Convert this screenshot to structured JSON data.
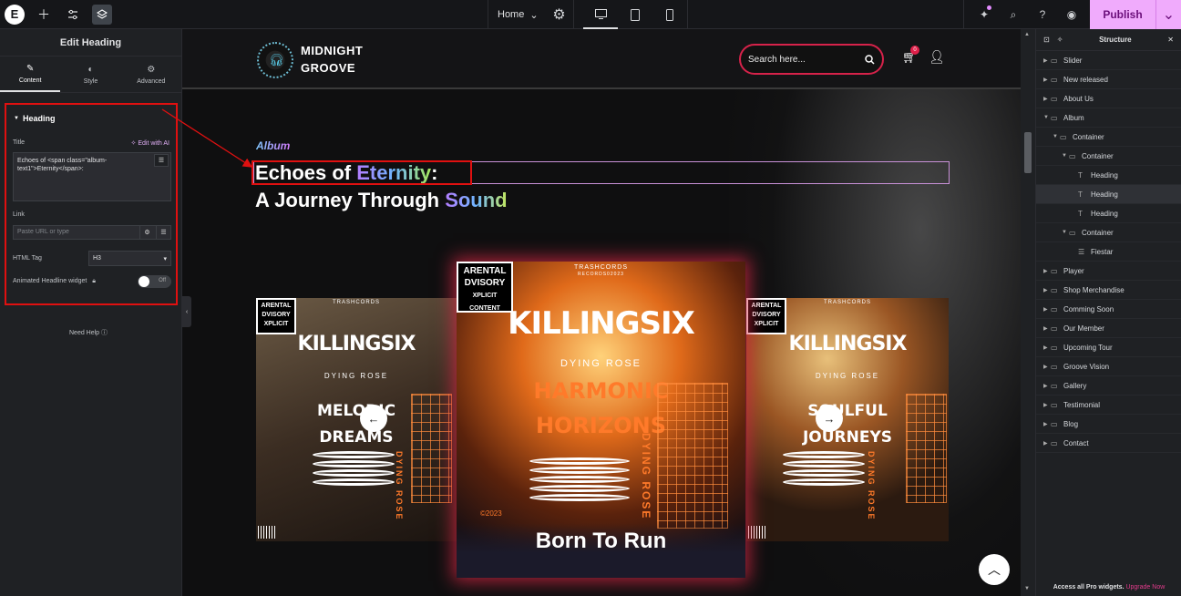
{
  "topbar": {
    "logo_letter": "E",
    "page_name": "Home",
    "publish_label": "Publish"
  },
  "left_panel": {
    "title": "Edit Heading",
    "tabs": [
      {
        "label": "Content"
      },
      {
        "label": "Style"
      },
      {
        "label": "Advanced"
      }
    ],
    "section_title": "Heading",
    "title_label": "Title",
    "edit_ai_label": "Edit with AI",
    "title_value": "Echoes of  <span class=\"album-text1\">Eternity</span>:",
    "link_label": "Link",
    "link_placeholder": "Paste URL or type",
    "html_tag_label": "HTML Tag",
    "html_tag_value": "H3",
    "animated_label": "Animated Headline widget",
    "toggle_off": "Off",
    "need_help": "Need Help"
  },
  "site": {
    "brand_line1": "MIDNIGHT",
    "brand_line2": "GROOVE",
    "search_placeholder": "Search here...",
    "cart_count": "0",
    "album_tag": "Album",
    "heading_line1_a": "Echoes of ",
    "heading_line1_b": "Eternity",
    "heading_line1_c": ":",
    "heading_line2_a": "A Journey Through ",
    "heading_line2_b": "Sound",
    "cards": {
      "label_small": "TRASHCORDS",
      "label_code": "RECORDS02023",
      "advisory": "ARENTAL\nDVISORY\nXPLICIT CONTENT",
      "band": "KILLINGSIX",
      "sub": "DYING ROSE",
      "left_title_1": "MELODIC",
      "left_title_2": "DREAMS",
      "center_title_1": "HARMONIC",
      "center_title_2": "HORIZONS",
      "right_title_1": "SOULFUL",
      "right_title_2": "JOURNEYS",
      "vertical": "DYING ROSE",
      "year": "©2023",
      "born": "Born To Run"
    }
  },
  "structure": {
    "title": "Structure",
    "items": [
      {
        "label": "Slider",
        "depth": 0,
        "caret": "▶",
        "icon": "▭"
      },
      {
        "label": "New released",
        "depth": 0,
        "caret": "▶",
        "icon": "▭"
      },
      {
        "label": "About Us",
        "depth": 0,
        "caret": "▶",
        "icon": "▭"
      },
      {
        "label": "Album",
        "depth": 0,
        "caret": "▼",
        "icon": "▭"
      },
      {
        "label": "Container",
        "depth": 1,
        "caret": "▼",
        "icon": "▭"
      },
      {
        "label": "Container",
        "depth": 2,
        "caret": "▼",
        "icon": "▭"
      },
      {
        "label": "Heading",
        "depth": 3,
        "caret": "",
        "icon": "T"
      },
      {
        "label": "Heading",
        "depth": 3,
        "caret": "",
        "icon": "T",
        "selected": true
      },
      {
        "label": "Heading",
        "depth": 3,
        "caret": "",
        "icon": "T"
      },
      {
        "label": "Container",
        "depth": 2,
        "caret": "▼",
        "icon": "▭"
      },
      {
        "label": "Fiestar",
        "depth": 3,
        "caret": "",
        "icon": "☰"
      },
      {
        "label": "Player",
        "depth": 0,
        "caret": "▶",
        "icon": "▭"
      },
      {
        "label": "Shop Merchandise",
        "depth": 0,
        "caret": "▶",
        "icon": "▭"
      },
      {
        "label": "Comming Soon",
        "depth": 0,
        "caret": "▶",
        "icon": "▭"
      },
      {
        "label": "Our Member",
        "depth": 0,
        "caret": "▶",
        "icon": "▭"
      },
      {
        "label": "Upcoming Tour",
        "depth": 0,
        "caret": "▶",
        "icon": "▭"
      },
      {
        "label": "Groove Vision",
        "depth": 0,
        "caret": "▶",
        "icon": "▭"
      },
      {
        "label": "Gallery",
        "depth": 0,
        "caret": "▶",
        "icon": "▭"
      },
      {
        "label": "Testimonial",
        "depth": 0,
        "caret": "▶",
        "icon": "▭"
      },
      {
        "label": "Blog",
        "depth": 0,
        "caret": "▶",
        "icon": "▭"
      },
      {
        "label": "Contact",
        "depth": 0,
        "caret": "▶",
        "icon": "▭"
      }
    ],
    "footer_text": "Access all Pro widgets.",
    "footer_link": "Upgrade Now"
  },
  "colors": {
    "accent_pink": "#f0abfc",
    "annotation_red": "#e01010",
    "search_border": "#d6224a"
  }
}
